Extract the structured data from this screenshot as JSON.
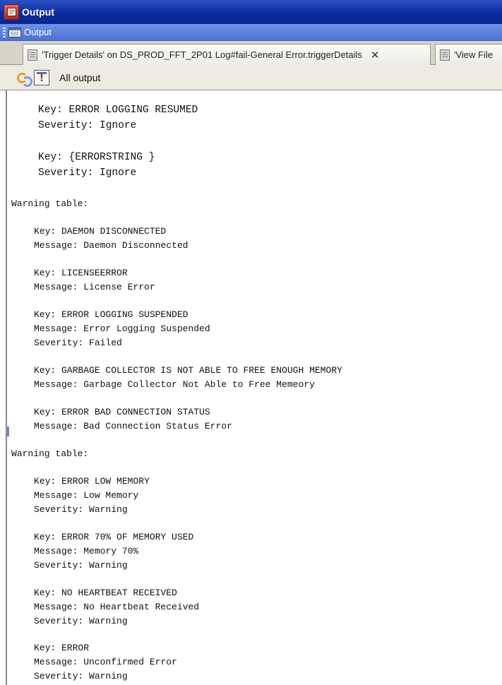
{
  "window": {
    "title": "Output",
    "view_label": "Output"
  },
  "tabs": [
    {
      "label": "'Trigger Details' on DS_PROD_FFT_2P01 Log#fail-General Error.triggerDetails",
      "close": "✕"
    },
    {
      "label": "'View File"
    }
  ],
  "toolbar": {
    "filter_label": "All output"
  },
  "output": {
    "resumed": {
      "key": "Key: ERROR LOGGING RESUMED",
      "severity": "Severity: Ignore"
    },
    "errorstring": {
      "key": "Key: {ERRORSTRING }",
      "severity": "Severity: Ignore"
    },
    "warning_table_1": {
      "header": "Warning table:",
      "entries": [
        {
          "key": "Key: DAEMON DISCONNECTED",
          "message": "Message: Daemon Disconnected"
        },
        {
          "key": "Key: LICENSEERROR",
          "message": "Message: License Error"
        },
        {
          "key": "Key: ERROR LOGGING SUSPENDED",
          "message": "Message: Error Logging Suspended",
          "severity": "Severity: Failed"
        },
        {
          "key": "Key: GARBAGE COLLECTOR IS NOT ABLE TO FREE ENOUGH MEMORY",
          "message": "Message: Garbage Collector Not Able to Free Memeory"
        },
        {
          "key": "Key: ERROR BAD CONNECTION STATUS",
          "message": "Message: Bad Connection Status Error"
        }
      ]
    },
    "warning_table_2": {
      "header": "Warning table:",
      "entries": [
        {
          "key": "Key: ERROR LOW MEMORY",
          "message": "Message: Low Memory",
          "severity": "Severity: Warning"
        },
        {
          "key": "Key: ERROR 70% OF MEMORY USED",
          "message": "Message: Memory 70%",
          "severity": "Severity: Warning"
        },
        {
          "key": "Key: NO HEARTBEAT RECEIVED",
          "message": "Message: No Heartbeat Received",
          "severity": "Severity: Warning"
        },
        {
          "key": "Key: ERROR",
          "message": "Message: Unconfirmed Error",
          "severity": "Severity: Warning"
        }
      ]
    }
  },
  "icons": {
    "title": "output-window-icon",
    "view": "output-view-icon",
    "tab": "document-icon",
    "sync": "sync-icon",
    "filter": "output-filter-icon"
  }
}
